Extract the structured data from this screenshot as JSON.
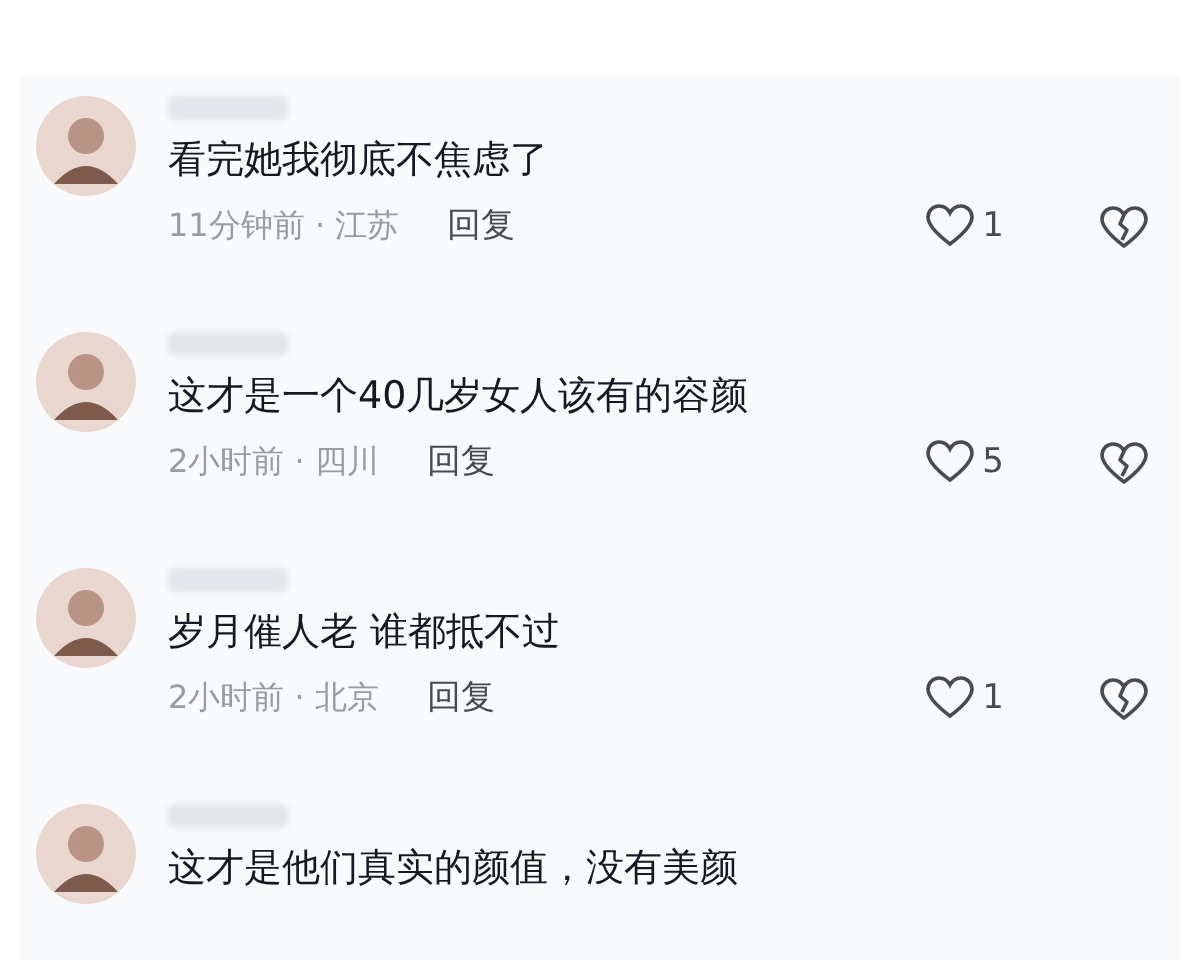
{
  "comments": [
    {
      "text": "看完她我彻底不焦虑了",
      "time": "11分钟前 · 江苏",
      "reply": "回复",
      "likes": "1"
    },
    {
      "text": "这才是一个40几岁女人该有的容颜",
      "time": "2小时前 · 四川",
      "reply": "回复",
      "likes": "5"
    },
    {
      "text": "岁月催人老 谁都抵不过",
      "time": "2小时前 · 北京",
      "reply": "回复",
      "likes": "1"
    },
    {
      "text": "这才是他们真实的颜值，没有美颜"
    }
  ]
}
